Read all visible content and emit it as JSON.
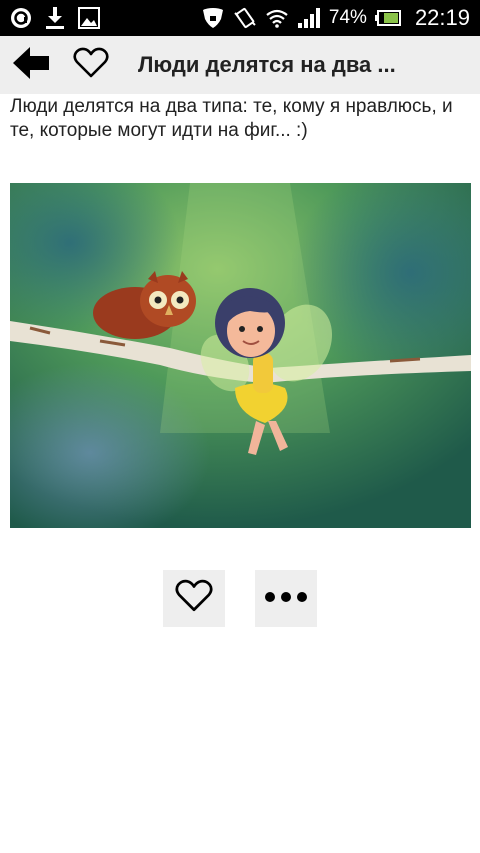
{
  "status_bar": {
    "battery_percent": "74%",
    "time": "22:19",
    "icons_left": [
      "app-notification-icon",
      "download-icon",
      "image-icon"
    ],
    "icons_right": [
      "shield-icon",
      "vibrate-icon",
      "wifi-icon",
      "signal-icon",
      "battery-icon"
    ]
  },
  "toolbar": {
    "title": "Люди делятся на два ...",
    "back_icon": "arrow-left-icon",
    "favorite_icon": "heart-outline-icon"
  },
  "post": {
    "text": "Люди делятся на два типа: те, кому я нравлюсь, и те, которые могут идти на фиг... :)",
    "image_description_icon": "owl-and-fairy-image"
  },
  "actions": {
    "like_icon": "heart-outline-icon",
    "more_icon": "more-dots-icon"
  }
}
